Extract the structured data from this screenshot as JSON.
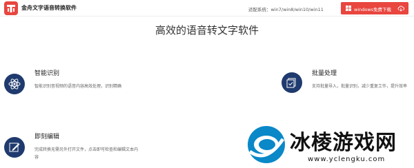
{
  "header": {
    "app_title": "金舟文字语音转换软件",
    "compat_text": "适配系统：win7/win8/win10/win11",
    "download_label": "windows免费下载",
    "brand_color": "#e8463f"
  },
  "headline": "高效的语音转文字软件",
  "features": [
    {
      "title": "智能识别",
      "desc": "智能识别音视频的语音内容高效处理，识别精确",
      "icon": "atom-icon"
    },
    {
      "title": "批量处理",
      "desc": "支持批量导入，批量识别，减少重复工作，提升效率",
      "icon": "checklist-icon"
    },
    {
      "title": "即刻编辑",
      "desc": "完成转换无需另外打开文件，点击即可检查和编辑文本内容",
      "icon": "edit-icon"
    }
  ],
  "watermark": {
    "text": "冰棱游戏网",
    "url": "www.yclengku.com"
  }
}
